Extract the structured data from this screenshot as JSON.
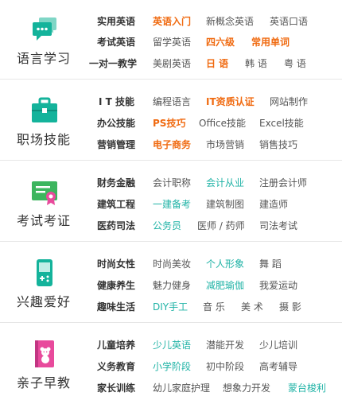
{
  "sections": [
    {
      "title": "语言学习",
      "icon": "chat-bubbles-icon",
      "color": "#14b39b",
      "rows": [
        [
          "实用英语",
          "英语入门",
          "新概念英语",
          "英语口语"
        ],
        [
          "考试英语",
          "留学英语",
          "四六级",
          "常用单词"
        ],
        [
          "一对一教学",
          "美剧英语",
          "日 语",
          "韩 语",
          "粤 语"
        ]
      ]
    },
    {
      "title": "职场技能",
      "icon": "briefcase-icon",
      "color": "#14b39b",
      "rows": [
        [
          "I T 技能",
          "编程语言",
          "IT资质认证",
          "网站制作"
        ],
        [
          "办公技能",
          "PS技巧",
          "Office技能",
          "Excel技能"
        ],
        [
          "营销管理",
          "电子商务",
          "市场营销",
          "销售技巧"
        ]
      ]
    },
    {
      "title": "考试考证",
      "icon": "certificate-icon",
      "color": "#3cb55e",
      "rows": [
        [
          "财务金融",
          "会计职称",
          "会计从业",
          "注册会计师"
        ],
        [
          "建筑工程",
          "一建备考",
          "建筑制图",
          "建造师"
        ],
        [
          "医药司法",
          "公务员",
          "医师 / 药师",
          "司法考试"
        ]
      ]
    },
    {
      "title": "兴趣爱好",
      "icon": "gamepad-icon",
      "color": "#14b39b",
      "rows": [
        [
          "时尚女性",
          "时尚美妆",
          "个人形象",
          "舞 蹈"
        ],
        [
          "健康养生",
          "魅力健身",
          "减肥瑜伽",
          "我爱运动"
        ],
        [
          "趣味生活",
          "DIY手工",
          "音 乐",
          "美 术",
          "摄 影"
        ]
      ]
    },
    {
      "title": "亲子早教",
      "icon": "teddy-book-icon",
      "color": "#e84a9c",
      "rows": [
        [
          "儿童培养",
          "少儿英语",
          "潜能开发",
          "少儿培训"
        ],
        [
          "义务教育",
          "小学阶段",
          "初中阶段",
          "高考辅导"
        ],
        [
          "家长训练",
          "幼儿家庭护理",
          "想象力开发",
          "蒙台梭利"
        ]
      ]
    }
  ]
}
